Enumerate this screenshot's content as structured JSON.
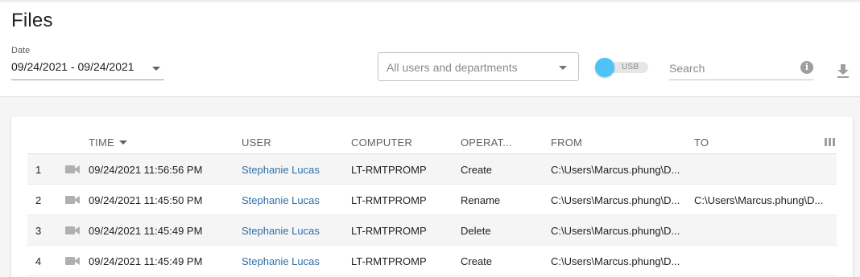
{
  "page": {
    "title": "Files"
  },
  "filters": {
    "date_label": "Date",
    "date_value": "09/24/2021 - 09/24/2021",
    "users_placeholder": "All users and departments",
    "usb_label": "USB",
    "search_placeholder": "Search"
  },
  "table": {
    "columns": [
      "TIME",
      "USER",
      "COMPUTER",
      "OPERAT...",
      "FROM",
      "TO"
    ],
    "rows": [
      {
        "num": "1",
        "time": "09/24/2021 11:56:56 PM",
        "user": "Stephanie Lucas",
        "computer": "LT-RMTPROMP",
        "operation": "Create",
        "from": "C:\\Users\\Marcus.phung\\D...",
        "to": ""
      },
      {
        "num": "2",
        "time": "09/24/2021 11:45:50 PM",
        "user": "Stephanie Lucas",
        "computer": "LT-RMTPROMP",
        "operation": "Rename",
        "from": "C:\\Users\\Marcus.phung\\D...",
        "to": "C:\\Users\\Marcus.phung\\D..."
      },
      {
        "num": "3",
        "time": "09/24/2021 11:45:49 PM",
        "user": "Stephanie Lucas",
        "computer": "LT-RMTPROMP",
        "operation": "Delete",
        "from": "C:\\Users\\Marcus.phung\\D...",
        "to": ""
      },
      {
        "num": "4",
        "time": "09/24/2021 11:45:49 PM",
        "user": "Stephanie Lucas",
        "computer": "LT-RMTPROMP",
        "operation": "Create",
        "from": "C:\\Users\\Marcus.phung\\D...",
        "to": ""
      }
    ]
  },
  "icons": {
    "row_icon": "video-camera-icon",
    "info": "info-icon",
    "download": "download-icon",
    "columns": "columns-icon"
  },
  "colors": {
    "accent": "#4fc3f7",
    "link": "#2f6fa8",
    "row_stripe": "#f5f5f5"
  }
}
